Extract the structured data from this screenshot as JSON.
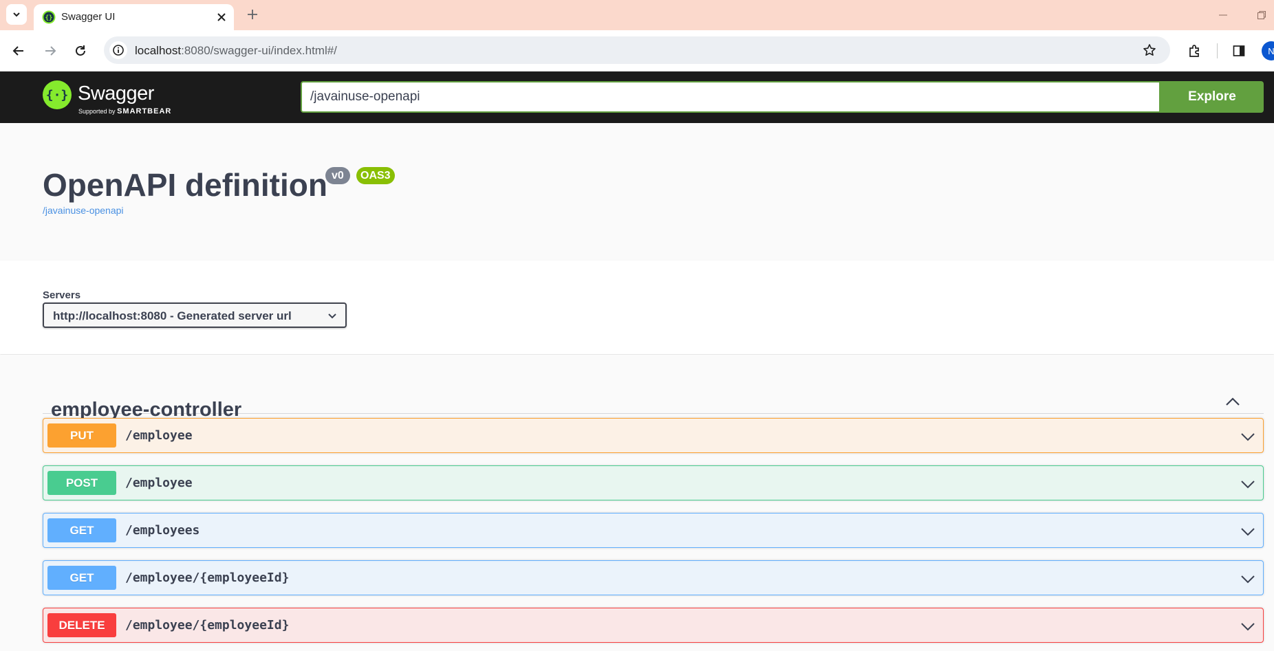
{
  "browser": {
    "tab_title": "Swagger UI",
    "url_host": "localhost",
    "url_rest": ":8080/swagger-ui/index.html#/",
    "profile_initial": "N"
  },
  "swagger_topbar": {
    "brand": "Swagger",
    "supported_by": "Supported by",
    "smartbear": "SMARTBEAR",
    "url_value": "/javainuse-openapi",
    "explore_label": "Explore"
  },
  "info": {
    "title": "OpenAPI definition",
    "version_badge": "v0",
    "oas_badge": "OAS3",
    "spec_link": "/javainuse-openapi"
  },
  "servers": {
    "label": "Servers",
    "selected": "http://localhost:8080 - Generated server url"
  },
  "tag": {
    "name": "employee-controller"
  },
  "operations": [
    {
      "method": "PUT",
      "path": "/employee"
    },
    {
      "method": "POST",
      "path": "/employee"
    },
    {
      "method": "GET",
      "path": "/employees"
    },
    {
      "method": "GET",
      "path": "/employee/{employeeId}"
    },
    {
      "method": "DELETE",
      "path": "/employee/{employeeId}"
    }
  ],
  "colors": {
    "put": "#fca130",
    "post": "#49cc90",
    "get": "#61affe",
    "delete": "#f93e3e",
    "explore_green": "#62a03f",
    "oas_green": "#89bf04"
  }
}
